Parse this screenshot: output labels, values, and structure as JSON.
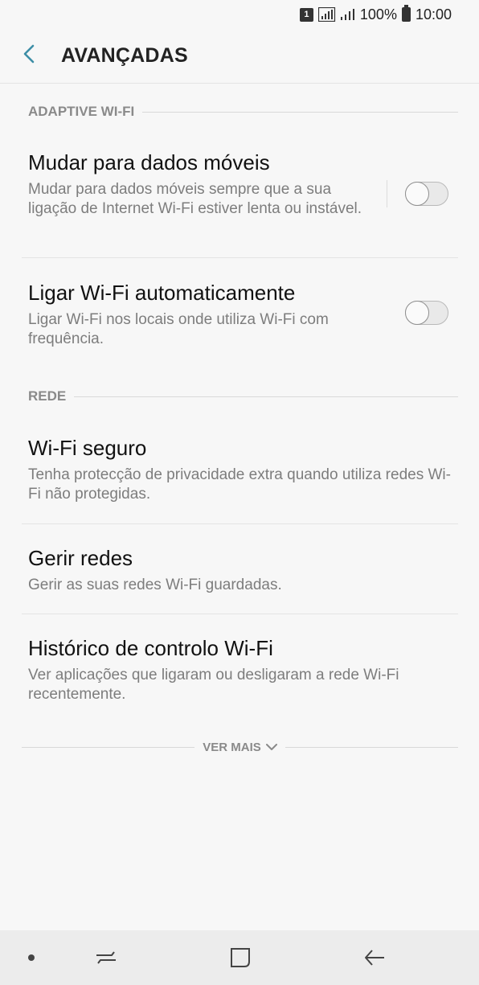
{
  "status_bar": {
    "sim_label": "1",
    "battery": "100%",
    "time": "10:00"
  },
  "header": {
    "title": "AVANÇADAS"
  },
  "sections": [
    {
      "label": "ADAPTIVE WI-FI",
      "items": [
        {
          "title": "Mudar para dados móveis",
          "summary": "Mudar para dados móveis sempre que a sua ligação de Internet Wi-Fi estiver lenta ou instável.",
          "toggle": false
        },
        {
          "title": "Ligar Wi-Fi automaticamente",
          "summary": "Ligar Wi-Fi nos locais onde utiliza Wi-Fi com frequência.",
          "toggle": false
        }
      ]
    },
    {
      "label": "REDE",
      "items": [
        {
          "title": "Wi-Fi seguro",
          "summary": "Tenha protecção de privacidade extra quando utiliza redes Wi-Fi não protegidas."
        },
        {
          "title": "Gerir redes",
          "summary": "Gerir as suas redes Wi-Fi guardadas."
        },
        {
          "title": "Histórico de controlo Wi-Fi",
          "summary": "Ver aplicações que ligaram ou desligaram a rede Wi-Fi recentemente."
        }
      ]
    }
  ],
  "see_more": {
    "label": "VER MAIS"
  },
  "colors": {
    "accent": "#3d8ea6",
    "background": "#f7f7f7",
    "nav_bar": "#ececec"
  },
  "icons": {
    "back": "chevron-left-icon",
    "see_more": "chevron-down-icon",
    "nav_dot": "dot-icon",
    "nav_recents": "recents-icon",
    "nav_home": "home-icon",
    "nav_back": "back-arrow-icon"
  }
}
